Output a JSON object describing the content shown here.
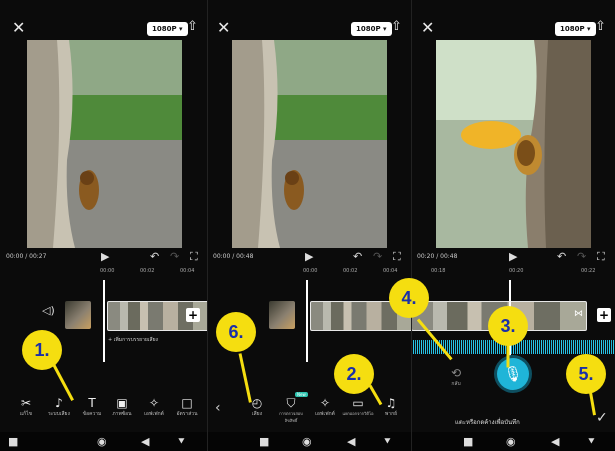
{
  "panels": [
    {
      "resolution": "1080P ▾",
      "time_current": "00:00",
      "time_total": "00:27",
      "ruler": [
        "00:00",
        "00:02",
        "00:04"
      ],
      "audio_hint": "+ เพิ่มการบรรยายเสียง",
      "tools": [
        {
          "icon": "scissors-icon",
          "glyph": "✂",
          "label": "แก้ไข"
        },
        {
          "icon": "music-note-icon",
          "glyph": "♪",
          "label": "ระบบเสียง"
        },
        {
          "icon": "text-icon",
          "glyph": "T",
          "label": "ข้อความ"
        },
        {
          "icon": "overlay-icon",
          "glyph": "▣",
          "label": "ภาพซ้อน"
        },
        {
          "icon": "effects-icon",
          "glyph": "✧",
          "label": "เอฟเฟกต์"
        },
        {
          "icon": "aspect-icon",
          "glyph": "□",
          "label": "อัตราส่วน"
        }
      ]
    },
    {
      "resolution": "1080P ▾",
      "time_current": "00:00",
      "time_total": "00:48",
      "ruler": [
        "00:00",
        "00:02",
        "00:04"
      ],
      "tools": [
        {
          "icon": "extract-audio-icon",
          "glyph": "◴",
          "label": "เสียง"
        },
        {
          "icon": "copyright-check-icon",
          "glyph": "⛉",
          "label": "การตรวจสอบลิขสิทธิ์",
          "badge": "New"
        },
        {
          "icon": "effects-icon",
          "glyph": "✧",
          "label": "เอฟเฟกต์"
        },
        {
          "icon": "folder-icon",
          "glyph": "▭",
          "label": "แยกออกจากวิดีโอ"
        },
        {
          "icon": "voiceover-icon",
          "glyph": "♫",
          "label": "พากย์"
        }
      ]
    },
    {
      "resolution": "1080P ▾",
      "time_current": "00:20",
      "time_total": "00:48",
      "ruler": [
        "00:18",
        "00:20",
        "00:22"
      ],
      "undo_label": "กลับ",
      "record_hint": "แตะหรือกดค้างเพื่อบันทึก"
    }
  ],
  "badges": [
    "1.",
    "2.",
    "3.",
    "4.",
    "5.",
    "6."
  ],
  "colors": {
    "badge": "#f5de10",
    "badge_text": "#1a2fa8",
    "record": "#1fb5d8"
  }
}
